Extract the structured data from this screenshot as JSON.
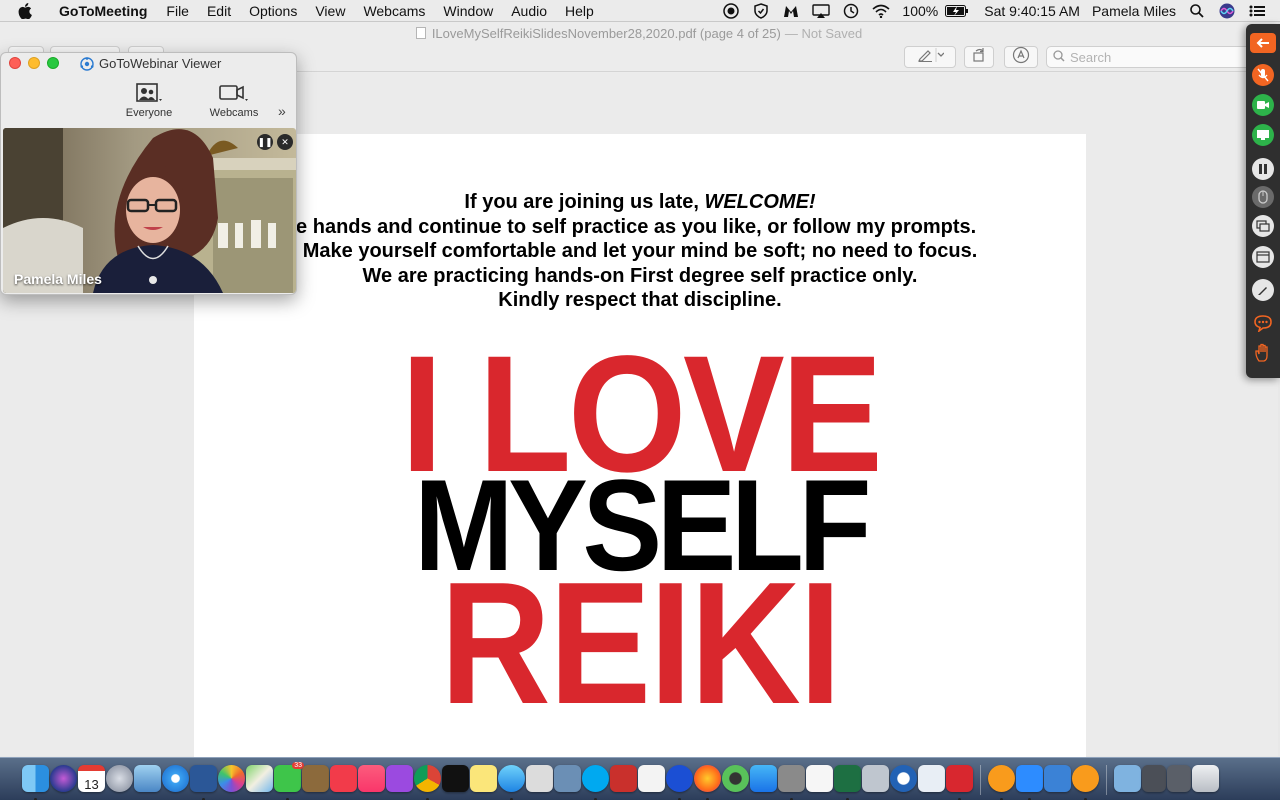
{
  "menubar": {
    "app_name": "GoToMeeting",
    "items": [
      "File",
      "Edit",
      "Options",
      "View",
      "Webcams",
      "Window",
      "Audio",
      "Help"
    ],
    "battery": "100%",
    "clock": "Sat 9:40:15 AM",
    "user": "Pamela Miles"
  },
  "preview": {
    "filename": "ILoveMySelfReikiSlidesNovember28,2020.pdf (page 4 of 25)",
    "status": "— Not Saved",
    "search_placeholder": "Search"
  },
  "slide": {
    "lines": [
      "If you are joining us late, ",
      "ace hands and continue to self practice as you like, or follow my prompts.",
      "Make yourself comfortable and let your mind be soft; no need to focus.",
      "We are practicing hands-on First degree self practice only.",
      "Kindly respect that discipline."
    ],
    "welcome": "WELCOME!",
    "logo_words": [
      "I LOVE",
      "MYSELF",
      "REIKI"
    ],
    "colors": {
      "red": "#d9272d",
      "black": "#000000"
    }
  },
  "viewer": {
    "title": "GoToWebinar Viewer",
    "tools": {
      "everyone": "Everyone",
      "webcams": "Webcams",
      "more": "»"
    },
    "webcam_name": "Pamela Miles"
  },
  "gtw_panel": {
    "buttons": [
      "collapse-arrow-icon",
      "microphone-icon",
      "camera-icon",
      "screen-share-icon",
      "pause-icon",
      "mouse-icon",
      "screens-icon",
      "window-icon",
      "pen-icon",
      "chat-icon",
      "hand-raise-icon"
    ],
    "accent": "#f26522",
    "green": "#2db34a"
  },
  "dock": {
    "calendar_day": "13",
    "badge_messages": "33",
    "apps": [
      "finder",
      "siri",
      "calendar",
      "launchpad",
      "preview",
      "safari",
      "word",
      "photos",
      "maps",
      "facetime",
      "notes-brown",
      "news",
      "music",
      "podcasts",
      "chrome",
      "appletv",
      "stickies",
      "messages",
      "screenshot",
      "keynote",
      "skype",
      "powerpoint-h",
      "textedit",
      "malwarebytes",
      "firefox",
      "aperture",
      "appstore",
      "screen-capture",
      "pricetag",
      "excel",
      "image-capture",
      "quicktime",
      "typeface",
      "quicken",
      "gotowebinar-1",
      "zoom",
      "privacy",
      "gotowebinar-2",
      "downloads",
      "mission-control",
      "trash"
    ]
  }
}
